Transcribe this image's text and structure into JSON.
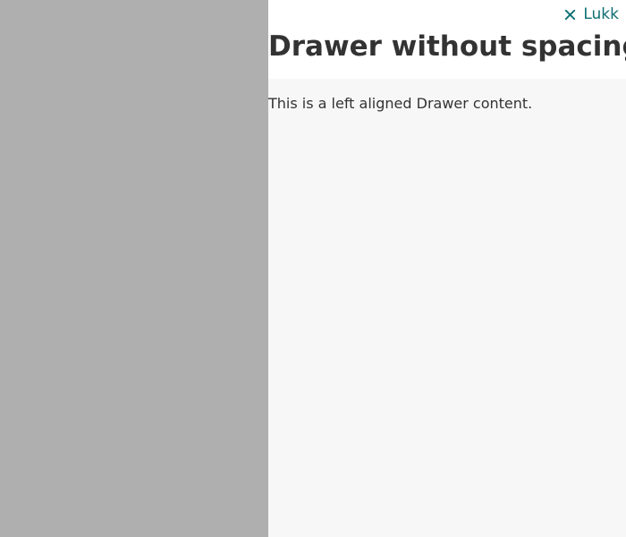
{
  "drawer": {
    "close_label": "Lukk",
    "title": "Drawer without spacing",
    "body_text": "This is a left aligned Drawer content."
  },
  "colors": {
    "backdrop": "#afafaf",
    "header_background": "#ffffff",
    "panel_background": "#f7f7f7",
    "accent": "#0f6f73",
    "text": "#333333"
  },
  "icons": {
    "close": "close-icon"
  }
}
